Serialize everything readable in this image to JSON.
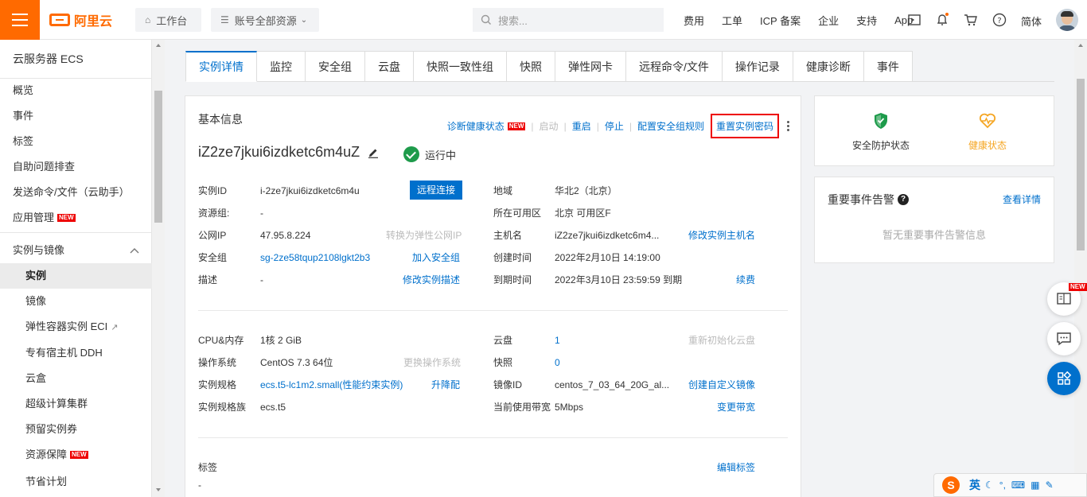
{
  "topbar": {
    "logo_text": "阿里云",
    "workbench": "工作台",
    "resources": "账号全部资源",
    "search_placeholder": "搜索...",
    "links": [
      "费用",
      "工单",
      "ICP 备案",
      "企业",
      "支持",
      "App"
    ],
    "language": "简体"
  },
  "sidebar": {
    "title": "云服务器 ECS",
    "items": [
      {
        "label": "概览"
      },
      {
        "label": "事件"
      },
      {
        "label": "标签"
      },
      {
        "label": "自助问题排查"
      },
      {
        "label": "发送命令/文件（云助手）"
      },
      {
        "label": "应用管理",
        "badge": "NEW"
      }
    ],
    "group": "实例与镜像",
    "sub_items": [
      {
        "label": "实例"
      },
      {
        "label": "镜像"
      },
      {
        "label": "弹性容器实例 ECI"
      },
      {
        "label": "专有宿主机 DDH"
      },
      {
        "label": "云盒"
      },
      {
        "label": "超级计算集群"
      },
      {
        "label": "预留实例券"
      },
      {
        "label": "资源保障",
        "badge": "NEW"
      },
      {
        "label": "节省计划"
      }
    ]
  },
  "tabs": [
    "实例详情",
    "监控",
    "安全组",
    "云盘",
    "快照一致性组",
    "快照",
    "弹性网卡",
    "远程命令/文件",
    "操作记录",
    "健康诊断",
    "事件"
  ],
  "basic": {
    "header": "基本信息",
    "actions": {
      "diagnose": "诊断健康状态",
      "diagnose_badge": "NEW",
      "start": "启动",
      "restart": "重启",
      "stop": "停止",
      "sg_rules": "配置安全组规则",
      "reset_password": "重置实例密码"
    },
    "instance_name": "iZ2ze7jkui6izdketc6m4uZ",
    "status": "运行中",
    "left_rows": [
      {
        "label": "实例ID",
        "value": "i-2ze7jkui6izdketc6m4u",
        "action": "远程连接"
      },
      {
        "label": "资源组:",
        "value": "-",
        "action": ""
      },
      {
        "label": "公网IP",
        "value": "47.95.8.224",
        "action": "转换为弹性公网IP"
      },
      {
        "label": "安全组",
        "value": "sg-2ze58tqup2108lgkt2b3",
        "action": "加入安全组"
      },
      {
        "label": "描述",
        "value": "-",
        "action": "修改实例描述"
      }
    ],
    "right_rows": [
      {
        "label": "地域",
        "value": "华北2（北京）",
        "action": ""
      },
      {
        "label": "所在可用区",
        "value": "北京 可用区F",
        "action": ""
      },
      {
        "label": "主机名",
        "value": "iZ2ze7jkui6izdketc6m4...",
        "action": "修改实例主机名"
      },
      {
        "label": "创建时间",
        "value": "2022年2月10日 14:19:00",
        "action": ""
      },
      {
        "label": "到期时间",
        "value": "2022年3月10日 23:59:59 到期",
        "action": "续费"
      }
    ],
    "left_rows2": [
      {
        "label": "CPU&内存",
        "value": "1核 2 GiB",
        "action": ""
      },
      {
        "label": "操作系统",
        "value": "CentOS 7.3 64位",
        "action": "更换操作系统"
      },
      {
        "label": "实例规格",
        "value": "ecs.t5-lc1m2.small(性能约束实例)",
        "action": "升降配"
      },
      {
        "label": "实例规格族",
        "value": "ecs.t5",
        "action": ""
      }
    ],
    "right_rows2": [
      {
        "label": "云盘",
        "value": "1",
        "action": "重新初始化云盘"
      },
      {
        "label": "快照",
        "value": "0",
        "action": ""
      },
      {
        "label": "镜像ID",
        "value": "centos_7_03_64_20G_al...",
        "action": "创建自定义镜像"
      },
      {
        "label": "当前使用带宽",
        "value": "5Mbps",
        "action": "变更带宽"
      }
    ],
    "tags_label": "标签",
    "tags_value": "-",
    "tags_action": "编辑标签"
  },
  "status_card": {
    "security": "安全防护状态",
    "health": "健康状态"
  },
  "events_card": {
    "title": "重要事件告警",
    "link": "查看详情",
    "empty": "暂无重要事件告警信息"
  },
  "float": {
    "badge": "NEW"
  },
  "ime": {
    "logo": "S",
    "lang": "英"
  },
  "colors": {
    "brand": "#ff6a00",
    "link": "#0070cc",
    "success": "#1e9b4b",
    "health": "#f5a623",
    "alert": "#e00000"
  }
}
